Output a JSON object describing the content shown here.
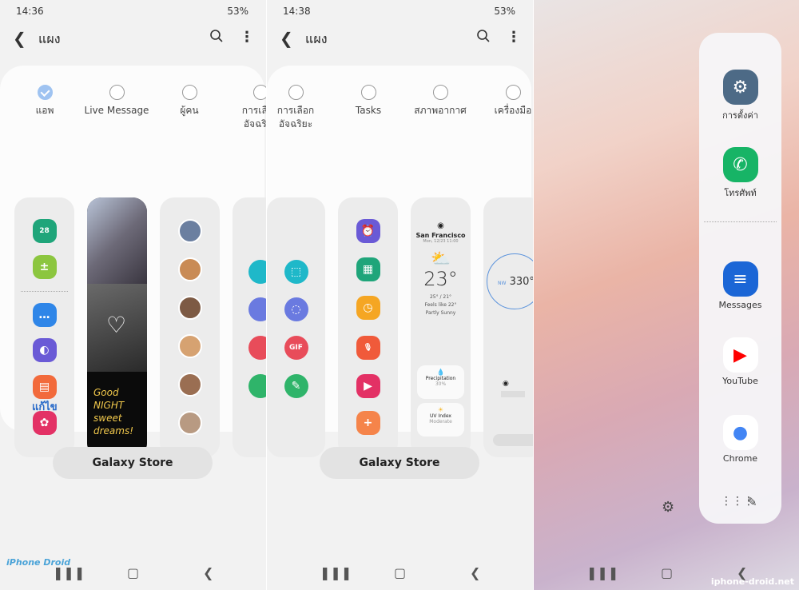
{
  "screen1": {
    "status": {
      "time": "14:36",
      "right": "53%"
    },
    "header": {
      "title": "แผง"
    },
    "options": [
      {
        "label": "แอพ",
        "selected": true
      },
      {
        "label": "Live Message",
        "selected": false
      },
      {
        "label": "ผู้คน",
        "selected": false
      },
      {
        "label": "การเลือกอัจฉริยะ",
        "selected": false
      }
    ],
    "apps_panel_icons": [
      {
        "name": "calendar",
        "color": "#1fa57a",
        "glyph": "28"
      },
      {
        "name": "calculator",
        "color": "#8cc63f",
        "glyph": "±"
      },
      {
        "name": "messages",
        "color": "#2f86e8",
        "glyph": "…"
      },
      {
        "name": "internet",
        "color": "#6a5ad6",
        "glyph": "◐"
      },
      {
        "name": "notes",
        "color": "#f26a3b",
        "glyph": "▤"
      },
      {
        "name": "gallery",
        "color": "#e33165",
        "glyph": "✿"
      }
    ],
    "live_message_text": "Good NIGHT sweet dreams!",
    "people_colors": [
      "#6b7fa0",
      "#c98b55",
      "#7d5a44",
      "#d6a271",
      "#9a6e52",
      "#b89a82"
    ],
    "edit_label": "แก้ไข",
    "galaxy_store": "Galaxy Store",
    "logo": "iPhone Droid"
  },
  "screen2": {
    "status": {
      "time": "14:38",
      "right": "53%"
    },
    "header": {
      "title": "แผง"
    },
    "options": [
      {
        "label": "การเลือกอัจฉริยะ",
        "selected": false
      },
      {
        "label": "Tasks",
        "selected": false
      },
      {
        "label": "สภาพอากาศ",
        "selected": false
      },
      {
        "label": "เครื่องมือ",
        "selected": false
      }
    ],
    "smart_select_icons": [
      {
        "name": "rectangle-select",
        "color": "#1fb8c9",
        "glyph": "⬚"
      },
      {
        "name": "oval-select",
        "color": "#6a7ae0",
        "glyph": "◌"
      },
      {
        "name": "animation-gif",
        "color": "#e84c5a",
        "glyph": "GIF"
      },
      {
        "name": "pin-to-screen",
        "color": "#2fb46a",
        "glyph": "✎"
      }
    ],
    "tasks_icons": [
      {
        "name": "alarm",
        "color": "#6a5ad6",
        "glyph": "⏰"
      },
      {
        "name": "calendar-event",
        "color": "#1fa57a",
        "glyph": "▦"
      },
      {
        "name": "reminder",
        "color": "#f5a623",
        "glyph": "◷"
      },
      {
        "name": "voice-recorder",
        "color": "#f05a3a",
        "glyph": "🎙"
      },
      {
        "name": "video",
        "color": "#e33165",
        "glyph": "▶"
      },
      {
        "name": "add",
        "color": "#f5844a",
        "glyph": "+"
      }
    ],
    "weather": {
      "city": "San Francisco",
      "date": "Mon, 12/23 11:00",
      "temp": "23°",
      "hilo": "25° / 21°",
      "feels": "Feels like 22°",
      "condition": "Partly Sunny",
      "precip_label": "Precipitation",
      "precip_value": "30%",
      "uv_label": "UV Index",
      "uv_value": "Moderate"
    },
    "compass": {
      "direction": "NW",
      "heading": "330°"
    },
    "galaxy_store": "Galaxy Store"
  },
  "screen3": {
    "edge_apps": [
      {
        "label": "การตั้งค่า",
        "icon": "settings-icon",
        "color": "#4d6a86",
        "glyph": "⚙"
      },
      {
        "label": "โทรศัพท์",
        "icon": "phone-icon",
        "color": "#17b466",
        "glyph": "✆"
      },
      {
        "label": "Messages",
        "icon": "messages-icon",
        "color": "#1b66d6",
        "glyph": "≡"
      },
      {
        "label": "YouTube",
        "icon": "youtube-icon",
        "color": "#ff0000",
        "glyph": "▶"
      },
      {
        "label": "Chrome",
        "icon": "chrome-icon",
        "color": "#4285f4",
        "glyph": "●"
      }
    ],
    "watermark": "iphone-droid.net"
  }
}
